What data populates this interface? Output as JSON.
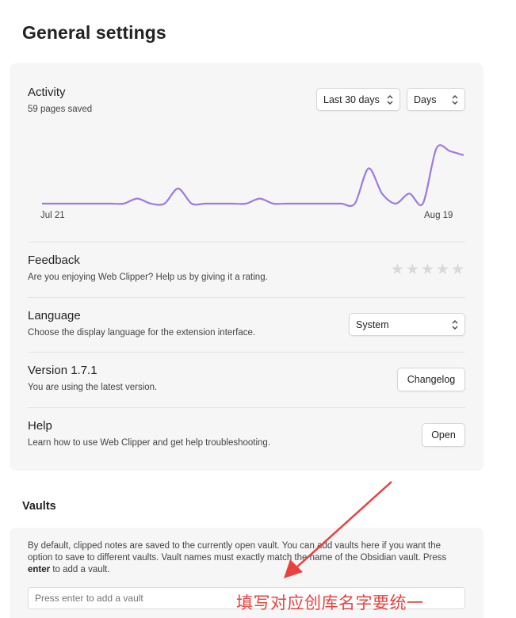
{
  "page": {
    "title": "General settings"
  },
  "activity": {
    "title": "Activity",
    "subtitle": "59 pages saved",
    "range_select": "Last 30 days",
    "unit_select": "Days"
  },
  "chart_data": {
    "type": "line",
    "title": "",
    "xlabel": "",
    "ylabel": "",
    "x_ticks": [
      "Jul 21",
      "Aug 19"
    ],
    "color": "#9c7be0",
    "series": [
      {
        "values": [
          0,
          0,
          0,
          0,
          0,
          0,
          0,
          0.5,
          0,
          0,
          1.5,
          0,
          0,
          0,
          0,
          0,
          0.5,
          0,
          0,
          0,
          0,
          0,
          0,
          0,
          3.5,
          1,
          0,
          1,
          0,
          5.5,
          5.2,
          4.8
        ]
      }
    ],
    "grid": false
  },
  "feedback": {
    "title": "Feedback",
    "desc": "Are you enjoying Web Clipper? Help us by giving it a rating.",
    "rating": 0,
    "max_rating": 5
  },
  "language": {
    "title": "Language",
    "desc": "Choose the display language for the extension interface.",
    "value": "System"
  },
  "version": {
    "title": "Version 1.7.1",
    "desc": "You are using the latest version.",
    "button": "Changelog"
  },
  "help": {
    "title": "Help",
    "desc": "Learn how to use Web Clipper and get help troubleshooting.",
    "button": "Open"
  },
  "vaults": {
    "title": "Vaults",
    "desc_part1": "By default, clipped notes are saved to the currently open vault. You can add vaults here if you want the option to save to different vaults. Vault names must exactly match the name of the Obsidian vault. Press ",
    "desc_key": "enter",
    "desc_part2": " to add a vault.",
    "input_placeholder": "Press enter to add a vault"
  },
  "annotation": {
    "text": "填写对应创库名字要统一",
    "color": "#e8423f"
  }
}
